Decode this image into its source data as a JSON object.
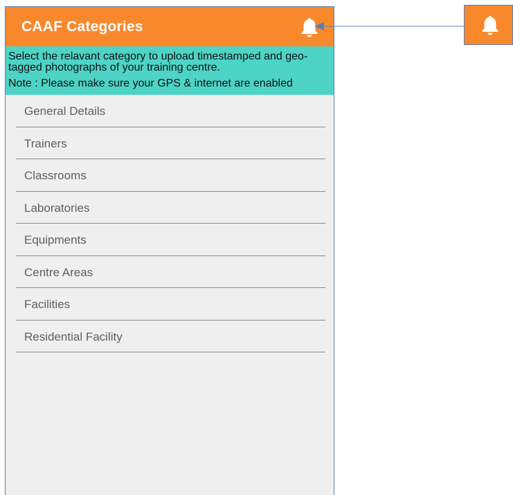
{
  "app": {
    "title": "CAAF Categories",
    "bell_icon": "bell-icon"
  },
  "info": {
    "instruction": "Select the relavant category to upload timestamped and geo-tagged photographs of your training centre.",
    "note": "Note : Please make sure your GPS & internet are enabled"
  },
  "categories": [
    {
      "label": "General Details"
    },
    {
      "label": "Trainers"
    },
    {
      "label": "Classrooms"
    },
    {
      "label": "Laboratories"
    },
    {
      "label": "Equipments"
    },
    {
      "label": "Centre Areas"
    },
    {
      "label": "Facilities"
    },
    {
      "label": "Residential Facility"
    }
  ],
  "colors": {
    "appbar": "#f7882c",
    "info_banner": "#4dd4c6",
    "list_background": "#efefef",
    "connector": "#5b7fb5"
  }
}
